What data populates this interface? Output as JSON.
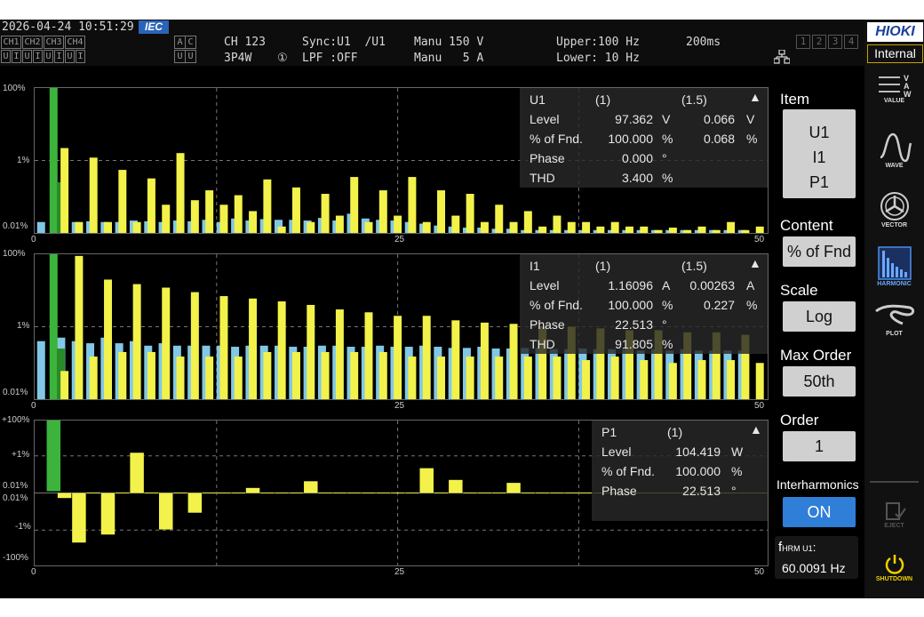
{
  "header": {
    "datetime": "2026-04-24 10:51:29",
    "standard": "IEC",
    "ch_row1": [
      "CH1",
      "CH2",
      "CH3",
      "CH4"
    ],
    "ch_row2": [
      "U",
      "I",
      "U",
      "I",
      "U",
      "I",
      "U",
      "I"
    ],
    "ac": [
      "A",
      "C"
    ],
    "uu": [
      "U",
      "U"
    ],
    "channel": "CH 123",
    "wiring": "3P4W",
    "sync": "Sync:U1  /U1",
    "circle_num": "①",
    "lpf": "LPF :OFF",
    "range_u": "Manu 150 V",
    "range_i": "Manu   5 A",
    "upper": "Upper:100 Hz",
    "lower": "Lower: 10 Hz",
    "interval": "200ms",
    "meas_boxes": [
      "1",
      "2",
      "3",
      "4"
    ],
    "network_icon": "network-icon"
  },
  "brand": {
    "logo": "HIOKI",
    "clock": "Internal"
  },
  "charts": {
    "u1": {
      "y_ticks": [
        "100%",
        "1%",
        "0.01%"
      ],
      "x_ticks": [
        "0",
        "25",
        "50"
      ]
    },
    "i1": {
      "y_ticks": [
        "100%",
        "1%",
        "0.01%"
      ],
      "x_ticks": [
        "0",
        "25",
        "50"
      ]
    },
    "p1": {
      "y_ticks": [
        "+100%",
        "+1%",
        "0.01%",
        "0.01%",
        "-1%",
        "-100%"
      ],
      "x_ticks": [
        "0",
        "25",
        "50"
      ]
    }
  },
  "panels": {
    "u1": {
      "name": "U1",
      "col1": "(1)",
      "col2": "(1.5)",
      "rows": [
        {
          "label": "Level",
          "v1": "97.362",
          "u1": "V",
          "v2": "0.066",
          "u2": "V"
        },
        {
          "label": "% of Fnd.",
          "v1": "100.000",
          "u1": "%",
          "v2": "0.068",
          "u2": "%"
        },
        {
          "label": "Phase",
          "v1": "0.000",
          "u1": "°",
          "v2": "",
          "u2": ""
        },
        {
          "label": "THD",
          "v1": "3.400",
          "u1": "%",
          "v2": "",
          "u2": ""
        }
      ]
    },
    "i1": {
      "name": "I1",
      "col1": "(1)",
      "col2": "(1.5)",
      "rows": [
        {
          "label": "Level",
          "v1": "1.16096",
          "u1": "A",
          "v2": "0.00263",
          "u2": "A"
        },
        {
          "label": "% of Fnd.",
          "v1": "100.000",
          "u1": "%",
          "v2": "0.227",
          "u2": "%"
        },
        {
          "label": "Phase",
          "v1": "22.513",
          "u1": "°",
          "v2": "",
          "u2": ""
        },
        {
          "label": "THD",
          "v1": "91.805",
          "u1": "%",
          "v2": "",
          "u2": ""
        }
      ]
    },
    "p1": {
      "name": "P1",
      "col1": "(1)",
      "rows": [
        {
          "label": "Level",
          "v1": "104.419",
          "u1": "W"
        },
        {
          "label": "% of Fnd.",
          "v1": "100.000",
          "u1": "%"
        },
        {
          "label": "Phase",
          "v1": "22.513",
          "u1": "°"
        }
      ]
    }
  },
  "settings": {
    "item_label": "Item",
    "items": [
      "U1",
      "I1",
      "P1"
    ],
    "content_label": "Content",
    "content_value": "% of Fnd",
    "scale_label": "Scale",
    "scale_value": "Log",
    "max_order_label": "Max Order",
    "max_order_value": "50th",
    "order_label": "Order",
    "order_value": "1",
    "interharmonics_label": "Interharmonics",
    "interharmonics_value": "ON",
    "freq_label_f": "f",
    "freq_label_sub": "HRM U1",
    "freq_label_colon": ":",
    "freq_value": "60.0091 Hz"
  },
  "sidebar": [
    {
      "name": "VALUE",
      "icon": "value-icon"
    },
    {
      "name": "WAVE",
      "icon": "wave-icon"
    },
    {
      "name": "VECTOR",
      "icon": "vector-icon"
    },
    {
      "name": "HARMONIC",
      "icon": "harmonic-icon"
    },
    {
      "name": "PLOT",
      "icon": "plot-icon"
    },
    {
      "name": "EJECT",
      "icon": "eject-icon"
    },
    {
      "name": "SHUTDOWN",
      "icon": "shutdown-icon"
    }
  ],
  "colors": {
    "harmonic": "#f2f24a",
    "interharmonic": "#82c8e6",
    "fundamental": "#3cb43c",
    "accent": "#2f7fd8"
  },
  "chart_data": [
    {
      "type": "bar",
      "name": "U1 harmonic",
      "y_scale": "log",
      "ylim_pct": [
        0.01,
        100
      ],
      "xlim": [
        0,
        50
      ],
      "fundamental_pct": 100,
      "harmonic_pct": [
        2.2,
        0.02,
        1.2,
        0.02,
        0.55,
        0.02,
        0.32,
        0.06,
        1.6,
        0.08,
        0.15,
        0.06,
        0.11,
        0.04,
        0.3,
        0.015,
        0.18,
        0.02,
        0.12,
        0.03,
        0.35,
        0.02,
        0.15,
        0.03,
        0.35,
        0.02,
        0.15,
        0.03,
        0.12,
        0.02,
        0.06,
        0.02,
        0.04,
        0.015,
        0.03,
        0.02,
        0.02,
        0.015,
        0.02,
        0.015,
        0.015,
        0.012,
        0.014,
        0.012,
        0.015,
        0.012,
        0.02,
        0.012,
        0.015
      ],
      "inter_pct": [
        0.02,
        0.024,
        0.02,
        0.021,
        0.02,
        0.02,
        0.022,
        0.021,
        0.02,
        0.022,
        0.021,
        0.023,
        0.02,
        0.025,
        0.022,
        0.024,
        0.023,
        0.023,
        0.022,
        0.026,
        0.022,
        0.034,
        0.025,
        0.023,
        0.022,
        0.02,
        0.018,
        0.016,
        0.015,
        0.014,
        0.014,
        0.013,
        0.013,
        0.012,
        0.012,
        0.012,
        0.012,
        0.012,
        0.012,
        0.012,
        0.012,
        0.012,
        0.012,
        0.012,
        0.012,
        0.012,
        0.012,
        0.012,
        0.012
      ]
    },
    {
      "type": "bar",
      "name": "I1 harmonic",
      "y_scale": "log",
      "ylim_pct": [
        0.01,
        100
      ],
      "xlim": [
        0,
        50
      ],
      "fundamental_pct": 100,
      "harmonic_pct": [
        0.06,
        90,
        0.15,
        20,
        0.2,
        15,
        0.2,
        12,
        0.15,
        9,
        0.15,
        7,
        0.15,
        6,
        0.2,
        5,
        0.2,
        4,
        0.2,
        3,
        0.2,
        2.5,
        0.2,
        2,
        0.15,
        2,
        0.15,
        1.5,
        0.15,
        1.3,
        0.15,
        1.2,
        0.15,
        1,
        0.15,
        1,
        0.12,
        0.9,
        0.15,
        0.8,
        0.12,
        0.8,
        0.1,
        0.7,
        0.12,
        0.7,
        0.12,
        0.6,
        0.1
      ],
      "inter_pct": [
        0.4,
        0.5,
        0.4,
        0.35,
        0.5,
        0.35,
        0.4,
        0.3,
        0.35,
        0.3,
        0.3,
        0.3,
        0.3,
        0.28,
        0.3,
        0.3,
        0.3,
        0.28,
        0.28,
        0.3,
        0.3,
        0.28,
        0.28,
        0.3,
        0.28,
        0.28,
        0.3,
        0.28,
        0.26,
        0.26,
        0.28,
        0.25,
        0.25,
        0.26,
        0.26,
        0.24,
        0.24,
        0.25,
        0.24,
        0.24,
        0.24,
        0.22,
        0.24,
        0.22,
        0.24,
        0.22,
        0.22,
        0.22,
        0.22
      ]
    },
    {
      "type": "bar",
      "name": "P1 harmonic",
      "y_scale": "signed-log",
      "xlim": [
        0,
        50
      ],
      "fundamental_pct": 100,
      "harmonic_pct": [
        -0.02,
        -9,
        0.01,
        -3,
        0.01,
        2.5,
        0.01,
        -1.5,
        0.01,
        -0.15,
        0.01,
        0.0,
        0.01,
        0.02,
        0.01,
        0.0,
        0.01,
        0.05,
        0.01,
        0.0,
        0.01,
        0.0,
        0.01,
        0.0,
        0.01,
        0.3,
        0.01,
        0.06,
        0.01,
        0.0,
        0.01,
        0.04,
        0.01,
        0.0,
        0.01,
        0.0,
        0.01,
        0.0,
        0.01,
        0.0,
        0.01,
        0.0,
        0.01,
        0.0,
        0.01,
        0.0,
        0.01,
        0.0,
        0.01
      ]
    }
  ]
}
